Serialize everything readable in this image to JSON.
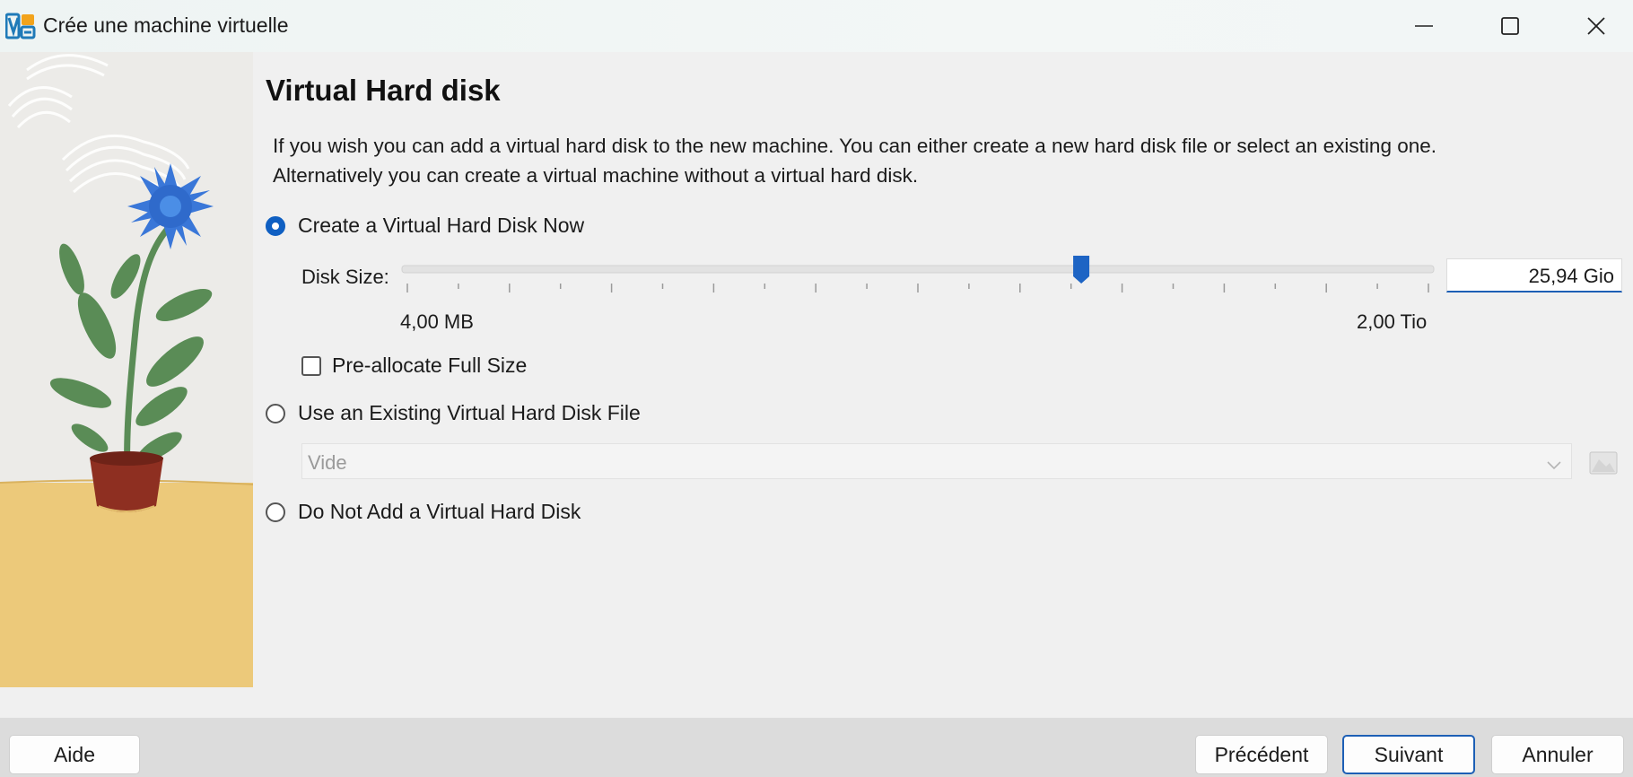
{
  "window": {
    "title": "Crée une machine virtuelle",
    "controls": [
      "minimize-icon",
      "maximize-icon",
      "close-icon"
    ]
  },
  "page": {
    "heading": "Virtual Hard disk",
    "description": "If you wish you can add a virtual hard disk to the new machine. You can either create a new hard disk file or select an existing one. Alternatively you can create a virtual machine without a virtual hard disk."
  },
  "options": {
    "create_now": {
      "label": "Create a Virtual Hard Disk Now",
      "selected": true
    },
    "use_existing": {
      "label": "Use an Existing Virtual Hard Disk File",
      "selected": false
    },
    "do_not_add": {
      "label": "Do Not Add a Virtual Hard Disk",
      "selected": false
    }
  },
  "disk": {
    "size_label": "Disk Size:",
    "size_value": "25,94 Gio",
    "min_label": "4,00 MB",
    "max_label": "2,00 Tio",
    "slider_fraction": 0.66,
    "preallocate_label": "Pre-allocate Full Size",
    "preallocate_checked": false
  },
  "existing_file": {
    "value": "Vide",
    "enabled": false
  },
  "footer": {
    "help_label": "Aide",
    "prev_label": "Précédent",
    "next_label": "Suivant",
    "cancel_label": "Annuler"
  },
  "colors": {
    "accent": "#0f5fc2",
    "floor": "#ecc97a",
    "wall": "#ecebe8",
    "flower": "#3a77d8",
    "leaf": "#5a8c56",
    "pot": "#8e2f21"
  }
}
